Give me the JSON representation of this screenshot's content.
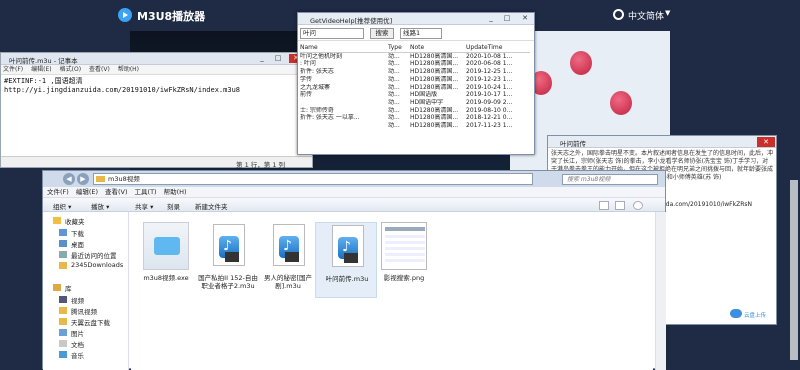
{
  "app": {
    "title": "M3U8播放器",
    "language": "中文简体"
  },
  "notepad": {
    "title": "叶问前传.m3u - 记事本",
    "menu": [
      "文件(F)",
      "编辑(E)",
      "格式(O)",
      "查看(V)",
      "帮助(H)"
    ],
    "lines": [
      "#EXTINF:-1 ,国语超清",
      "http://yi.jingdianzuida.com/20191010/iwFkZRsN/index.m3u8"
    ],
    "status": "第 1 行，第 1 列"
  },
  "help": {
    "title": "GetVideoHelp[推荐使用优]",
    "search_value": "叶问",
    "search_button": "搜索",
    "source_select": "线路1",
    "columns": [
      "Name",
      "Type",
      "Note",
      "UpdateTime"
    ],
    "rows": [
      [
        "叶问之他机时刻",
        "动...",
        "HD1280高清国...",
        "2020-10-08 1..."
      ],
      [
        ": 叶问",
        "动...",
        "HD1280高清国...",
        "2020-06-08 1..."
      ],
      [
        "折件: 张天志",
        "动...",
        "HD1280高清国...",
        "2019-12-25 1..."
      ],
      [
        "学传",
        "动...",
        "HD1280高清国...",
        "2019-12-23 1..."
      ],
      [
        "之九龙城寨",
        "动...",
        "HD1280高清国...",
        "2019-10-24 1..."
      ],
      [
        "前传",
        "动...",
        "HD国语版",
        "2019-10-17 1..."
      ],
      [
        "",
        "动...",
        "HD国语中字",
        "2019-09-09 2..."
      ],
      [
        "士: 宗师传奇",
        "动...",
        "HD1280高清国...",
        "2019-08-10 0..."
      ],
      [
        "折件: 张天志 一以拿...",
        "动...",
        "HD1280高清国...",
        "2018-12-21 0..."
      ],
      [
        "",
        "动...",
        "HD1280高清国...",
        "2017-11-23 1..."
      ]
    ]
  },
  "info": {
    "title": "叶问前传",
    "text": "张天志之外，国际拳击明星不变。本片叙述闻者信息在发生了的信息时间，此后，冲突了长江，宗师(张天志 饰)的拳击，李小龙看学名师协张(冼宝宝 饰)丁手学习，对于港岛拳击拳王的能力开始，但在这个被拒绝在明兄弟之间挑拨与回，就年龄要张成(杨华英 饰)与马胖(朱本阳 饰)先(樊少皇 饰)和小师傅英雄(苏 饰)",
    "url": "nda.com/20191010/iwFkZRsN",
    "cloud_label": "云盘上传"
  },
  "explorer": {
    "path": "m3u8视频",
    "search_placeholder": "搜索 m3u8视频",
    "menu": [
      "文件(F)",
      "编辑(E)",
      "查看(V)",
      "工具(T)",
      "帮助(H)"
    ],
    "commands": [
      "组织 ▾",
      "播放 ▾",
      "共享 ▾",
      "刻录",
      "新建文件夹"
    ],
    "nav": {
      "favorites_header": "收藏夹",
      "favorites": [
        "下载",
        "桌面",
        "最近访问的位置",
        "2345Downloads"
      ],
      "library_header": "库",
      "library": [
        "视频",
        "腾讯视频",
        "天翼云盘下载",
        "图片",
        "文档",
        "音乐"
      ]
    },
    "files": [
      {
        "name": "m3u8视频.exe",
        "kind": "exe"
      },
      {
        "name": "国产私拍II 152-自由职业者格子2.m3u",
        "kind": "m3u"
      },
      {
        "name": "男人的秘密[国产剧].m3u",
        "kind": "m3u"
      },
      {
        "name": "叶问前传.m3u",
        "kind": "m3u"
      },
      {
        "name": "影视搜索.png",
        "kind": "png"
      }
    ]
  },
  "colors": {
    "header_bg": "#1f2a44",
    "accent": "#3da2f3",
    "lantern": "#c0223f"
  }
}
